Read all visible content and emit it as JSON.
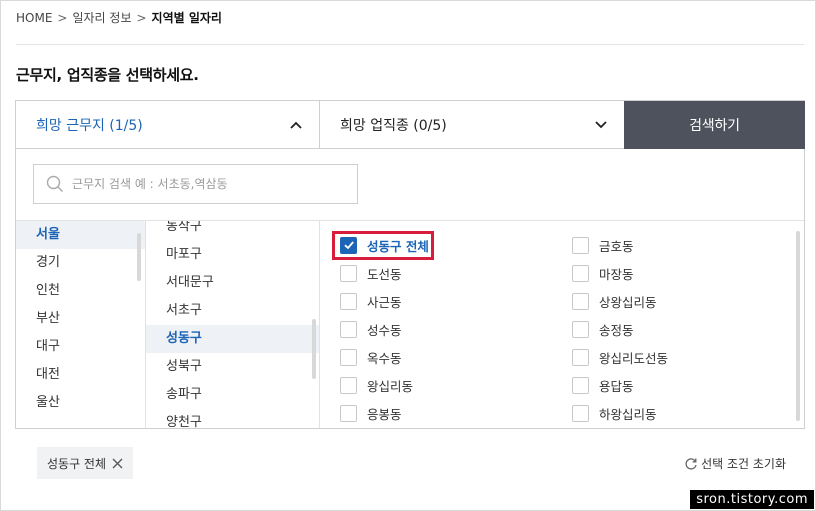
{
  "breadcrumb": {
    "home": "HOME",
    "sep1": ">",
    "level1": "일자리 정보",
    "sep2": ">",
    "current": "지역별 일자리"
  },
  "section_title": "근무지, 업직종을 선택하세요.",
  "tabs": {
    "location": "희망 근무지 (1/5)",
    "job": "희망 업직종 (0/5)",
    "search_button": "검색하기"
  },
  "search": {
    "placeholder": "근무지 검색 예 : 서초동,역삼동"
  },
  "regions": [
    {
      "label": "서울",
      "selected": true
    },
    {
      "label": "경기",
      "selected": false
    },
    {
      "label": "인천",
      "selected": false
    },
    {
      "label": "부산",
      "selected": false
    },
    {
      "label": "대구",
      "selected": false
    },
    {
      "label": "대전",
      "selected": false
    },
    {
      "label": "울산",
      "selected": false
    }
  ],
  "districts": [
    {
      "label": "동작구",
      "selected": false
    },
    {
      "label": "마포구",
      "selected": false
    },
    {
      "label": "서대문구",
      "selected": false
    },
    {
      "label": "서초구",
      "selected": false
    },
    {
      "label": "성동구",
      "selected": true
    },
    {
      "label": "성북구",
      "selected": false
    },
    {
      "label": "송파구",
      "selected": false
    },
    {
      "label": "양천구",
      "selected": false
    }
  ],
  "neighborhoods": {
    "left": [
      {
        "label": "성동구 전체",
        "checked": true
      },
      {
        "label": "도선동",
        "checked": false
      },
      {
        "label": "사근동",
        "checked": false
      },
      {
        "label": "성수동",
        "checked": false
      },
      {
        "label": "옥수동",
        "checked": false
      },
      {
        "label": "왕십리동",
        "checked": false
      },
      {
        "label": "응봉동",
        "checked": false
      }
    ],
    "right": [
      {
        "label": "금호동",
        "checked": false
      },
      {
        "label": "마장동",
        "checked": false
      },
      {
        "label": "상왕십리동",
        "checked": false
      },
      {
        "label": "송정동",
        "checked": false
      },
      {
        "label": "왕십리도선동",
        "checked": false
      },
      {
        "label": "용답동",
        "checked": false
      },
      {
        "label": "하왕십리동",
        "checked": false
      }
    ]
  },
  "selected_chip": "성동구 전체",
  "reset_label": "선택 조건 초기화",
  "watermark": "sron.tistory.com",
  "colors": {
    "accent": "#1b64b6",
    "search_button_bg": "#4d525c",
    "highlight": "#d81c3c"
  }
}
